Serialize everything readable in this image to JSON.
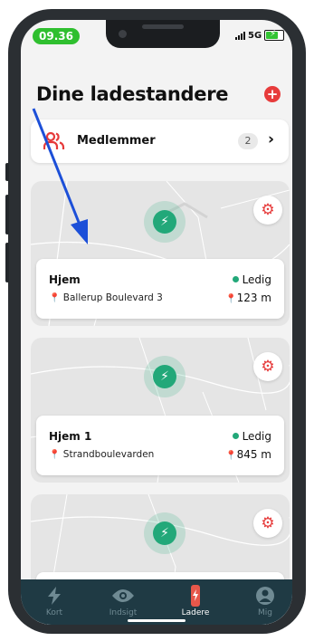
{
  "status_bar": {
    "time": "09.36",
    "network": "5G"
  },
  "page_title": "Dine ladestandere",
  "members": {
    "label": "Medlemmer",
    "count": "2",
    "chevron": "›"
  },
  "chargers": [
    {
      "name": "Hjem",
      "address": "Ballerup Boulevard 3",
      "status": "Ledig",
      "distance": "123 m"
    },
    {
      "name": "Hjem 1",
      "address": "Strandboulevarden",
      "status": "Ledig",
      "distance": "845 m"
    },
    {
      "name": "",
      "address": "",
      "status": "",
      "distance": ""
    }
  ],
  "tabs": [
    {
      "label": "Kort",
      "icon": "lightning-icon"
    },
    {
      "label": "Indsigt",
      "icon": "eye-icon"
    },
    {
      "label": "Ladere",
      "icon": "charger-icon"
    },
    {
      "label": "Mig",
      "icon": "user-icon"
    }
  ],
  "colors": {
    "accent_red": "#e63a3a",
    "accent_green": "#22a879",
    "tabbar": "#1f3a44",
    "time_pill": "#2fbf2f"
  }
}
